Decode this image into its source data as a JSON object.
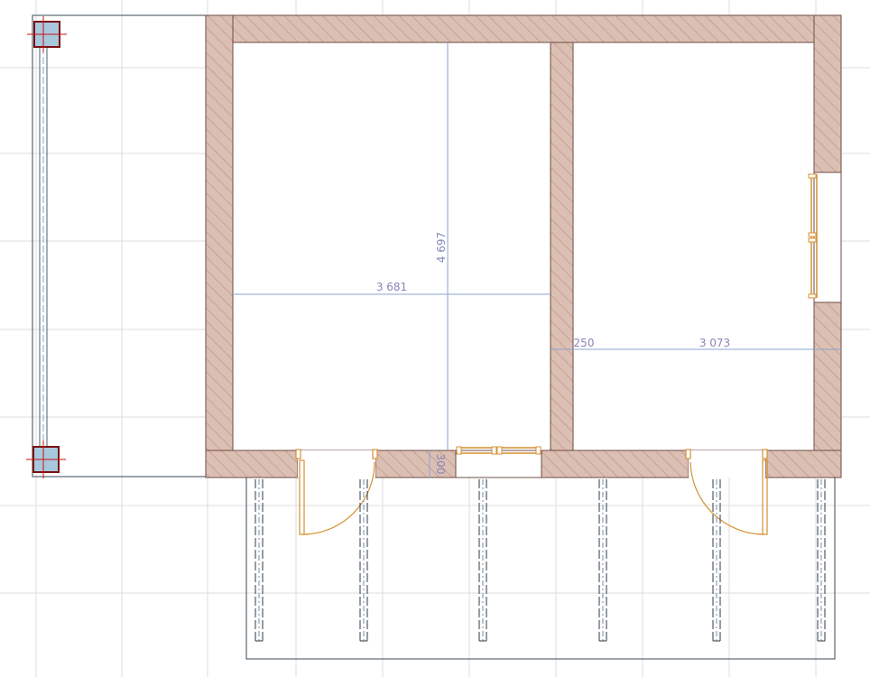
{
  "colors": {
    "wall_fill": "#dcbfb3",
    "wall_hatch": "#b88f83",
    "wall_outline": "#6e4d45",
    "grid": "#dcdcdc",
    "dimension": "#8aa3cf",
    "dimension_text": "#8a84b8",
    "door_window": "#d69033",
    "column_fill": "#a8c8de",
    "column_cross": "#cc1111",
    "post_line": "#333a40",
    "terrace_line": "#3a4a55"
  },
  "dimensions": {
    "room_width_left": "3 681",
    "room_height": "4 697",
    "wall_thickness": "250",
    "room_width_right": "3 073",
    "opening_depth": "300"
  }
}
